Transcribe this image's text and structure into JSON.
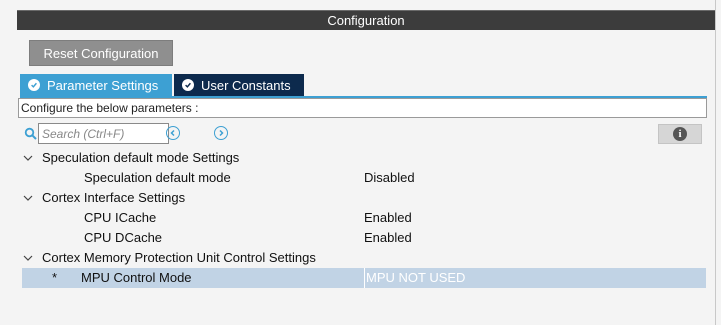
{
  "window": {
    "title": "Configuration"
  },
  "toolbar": {
    "reset_label": "Reset Configuration"
  },
  "tabs": [
    {
      "label": "Parameter Settings",
      "active": true
    },
    {
      "label": "User Constants",
      "active": false
    }
  ],
  "description": "Configure the below parameters :",
  "search": {
    "placeholder": "Search (Ctrl+F)",
    "value": ""
  },
  "tree": {
    "groups": [
      {
        "label": "Speculation default mode Settings",
        "params": [
          {
            "name": "Speculation default mode",
            "value": "Disabled"
          }
        ]
      },
      {
        "label": "Cortex Interface Settings",
        "params": [
          {
            "name": "CPU ICache",
            "value": "Enabled"
          },
          {
            "name": "CPU DCache",
            "value": "Enabled"
          }
        ]
      },
      {
        "label": "Cortex Memory Protection Unit Control Settings",
        "params": [
          {
            "marker": "*",
            "name": "MPU Control Mode",
            "value": "MPU NOT USED"
          }
        ]
      }
    ]
  },
  "colors": {
    "accent": "#3da0d3",
    "tab_inactive": "#0d2a4d",
    "titlebar": "#3c3c3c",
    "selected_row": "#c1d3e5",
    "button": "#8f8f8f"
  },
  "icons": [
    "check-circle-icon",
    "search-icon",
    "arrow-left-circle-icon",
    "arrow-right-circle-icon",
    "info-icon",
    "chevron-down-icon"
  ]
}
